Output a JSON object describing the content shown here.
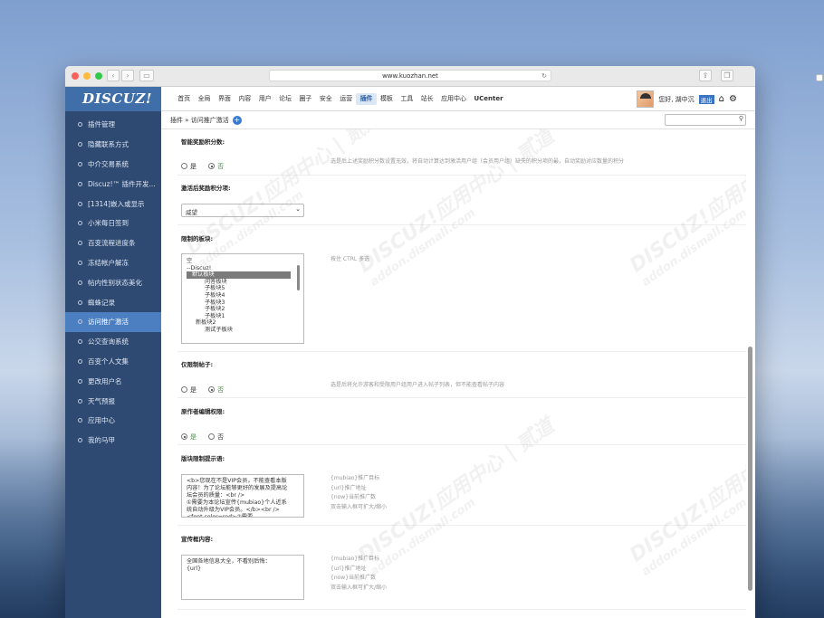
{
  "browser": {
    "url": "www.kuozhan.net"
  },
  "logo": "DISCUZ!",
  "sidebar": {
    "items": [
      "插件管理",
      "隐藏联系方式",
      "中介交易系统",
      "Discuz!™ 插件开发...",
      "[1314]嵌入或显示",
      "小米每日签到",
      "百变流程进度条",
      "冻结帐户解冻",
      "帖内性别状态美化",
      "蜘蛛记录",
      "访问推广激活",
      "公交查询系统",
      "百变个人文集",
      "更改用户名",
      "天气预报",
      "应用中心",
      "我的马甲"
    ],
    "active_index": 10
  },
  "topnav": {
    "items": [
      "首页",
      "全局",
      "界面",
      "内容",
      "用户",
      "论坛",
      "圈子",
      "安全",
      "运营",
      "插件",
      "模板",
      "工具",
      "站长",
      "应用中心",
      "UCenter"
    ],
    "active_index": 9
  },
  "user": {
    "greeting": "您好, 湖中沉",
    "logout": "退出"
  },
  "breadcrumb": "插件 » 访问推广激活",
  "form": {
    "f1": {
      "label": "智能奖励积分数:",
      "opt_yes": "是",
      "opt_no": "否",
      "selected": "否",
      "tip": "选是后上述奖励积分数设置无效，将自动计算达到激活用户组（会员用户组）缺失的积分项的最，自动奖励对应数量的积分"
    },
    "f2": {
      "label": "激活后奖励积分项:",
      "value": "威望"
    },
    "f3": {
      "label": "限制的板块:",
      "tip": "按住 CTRL 多选",
      "options": [
        "空",
        "--Discuz!",
        "默认板块",
        "问答板块",
        "子板块5",
        "子板块4",
        "子板块3",
        "子板块2",
        "子板块1",
        "新板块2",
        "测试子板块"
      ],
      "selected_index": 2
    },
    "f4": {
      "label": "仅限制帖子:",
      "opt_yes": "是",
      "opt_no": "否",
      "selected": "否",
      "tip": "选是后将允许游客和受限用户组用户进入帖子列表，但不能查看帖子内容"
    },
    "f5": {
      "label": "原作者编辑权限:",
      "opt_yes": "是",
      "opt_no": "否",
      "selected": "是"
    },
    "f6": {
      "label": "版块限制提示语:",
      "lines": [
        "<b>您现在不是VIP会员，不能查看本版",
        "内容！为了论坛能够更好的发展及提高论",
        "坛会员的质量：<br />",
        "①需要为本论坛宣传{mubiao}个人近系",
        "统自动升级为VIP会员。</b><br />",
        "<font color=red>②需要..."
      ],
      "vars": [
        "{mubiao}推广目标",
        "{url}推广地址",
        "{now}当前推广数",
        "双击输入框可扩大/缩小"
      ]
    },
    "f7": {
      "label": "宣传框内容:",
      "lines": [
        "全国各地信息大全，不看别后悔：",
        "{url}"
      ],
      "vars": [
        "{mubiao}推广目标",
        "{url}推广地址",
        "{now}当前推广数",
        "双击输入框可扩大/缩小"
      ]
    }
  },
  "watermark": {
    "main": "DISCUZ!应用中心 | 贰道",
    "sub": "addon.dismall.com"
  }
}
